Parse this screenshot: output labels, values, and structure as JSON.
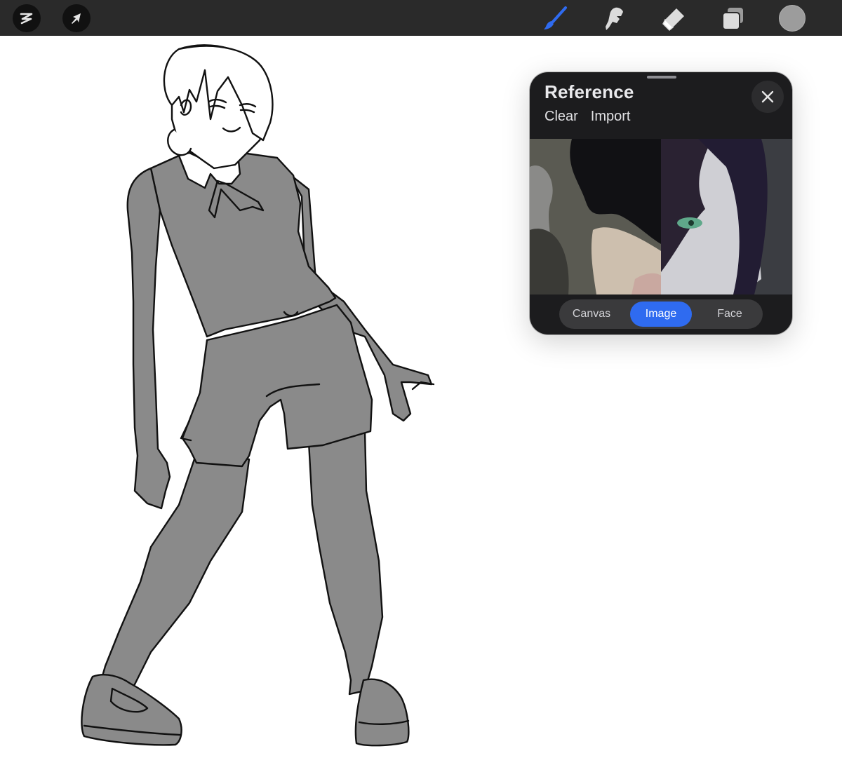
{
  "toolbar": {
    "left_buttons": [
      {
        "name": "adjustments",
        "icon": "adjustments-s-icon"
      },
      {
        "name": "selection",
        "icon": "arrow-cursor-icon"
      }
    ],
    "tools": [
      {
        "name": "brush",
        "icon": "brush-icon",
        "active": true
      },
      {
        "name": "smudge",
        "icon": "smudge-icon",
        "active": false
      },
      {
        "name": "eraser",
        "icon": "eraser-icon",
        "active": false
      },
      {
        "name": "layers",
        "icon": "layers-icon",
        "active": false
      }
    ],
    "color": {
      "icon": "color-swatch",
      "hex": "#9c9c9c"
    },
    "accent": "#2f6bf0"
  },
  "reference": {
    "title": "Reference",
    "actions": [
      "Clear",
      "Import"
    ],
    "close_icon": "close-icon",
    "segments": [
      {
        "label": "Canvas",
        "active": false
      },
      {
        "label": "Image",
        "active": true
      },
      {
        "label": "Face",
        "active": false
      }
    ]
  },
  "canvas": {
    "fill_color": "#8a8a8a",
    "line_color": "#111111",
    "background": "#ffffff"
  }
}
